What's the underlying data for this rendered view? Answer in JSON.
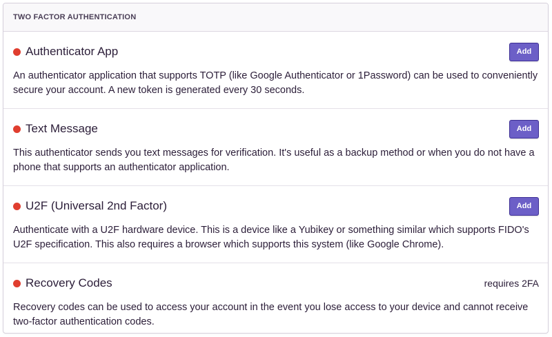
{
  "panel": {
    "header": "TWO FACTOR AUTHENTICATION"
  },
  "colors": {
    "status_dot": "#e03e2f",
    "button_bg": "#6c5fc7",
    "button_border": "#3d2f94",
    "text": "#2b1d38"
  },
  "methods": [
    {
      "title": "Authenticator App",
      "action_label": "Add",
      "description": "An authenticator application that supports TOTP (like Google Authenticator or 1Password) can be used to conveniently secure your account. A new token is generated every 30 seconds."
    },
    {
      "title": "Text Message",
      "action_label": "Add",
      "description": "This authenticator sends you text messages for verification. It's useful as a backup method or when you do not have a phone that supports an authenticator application."
    },
    {
      "title": "U2F (Universal 2nd Factor)",
      "action_label": "Add",
      "description": "Authenticate with a U2F hardware device. This is a device like a Yubikey or something similar which supports FIDO's U2F specification. This also requires a browser which supports this system (like Google Chrome)."
    },
    {
      "title": "Recovery Codes",
      "requirement": "requires 2FA",
      "description": "Recovery codes can be used to access your account in the event you lose access to your device and cannot receive two-factor authentication codes."
    }
  ]
}
